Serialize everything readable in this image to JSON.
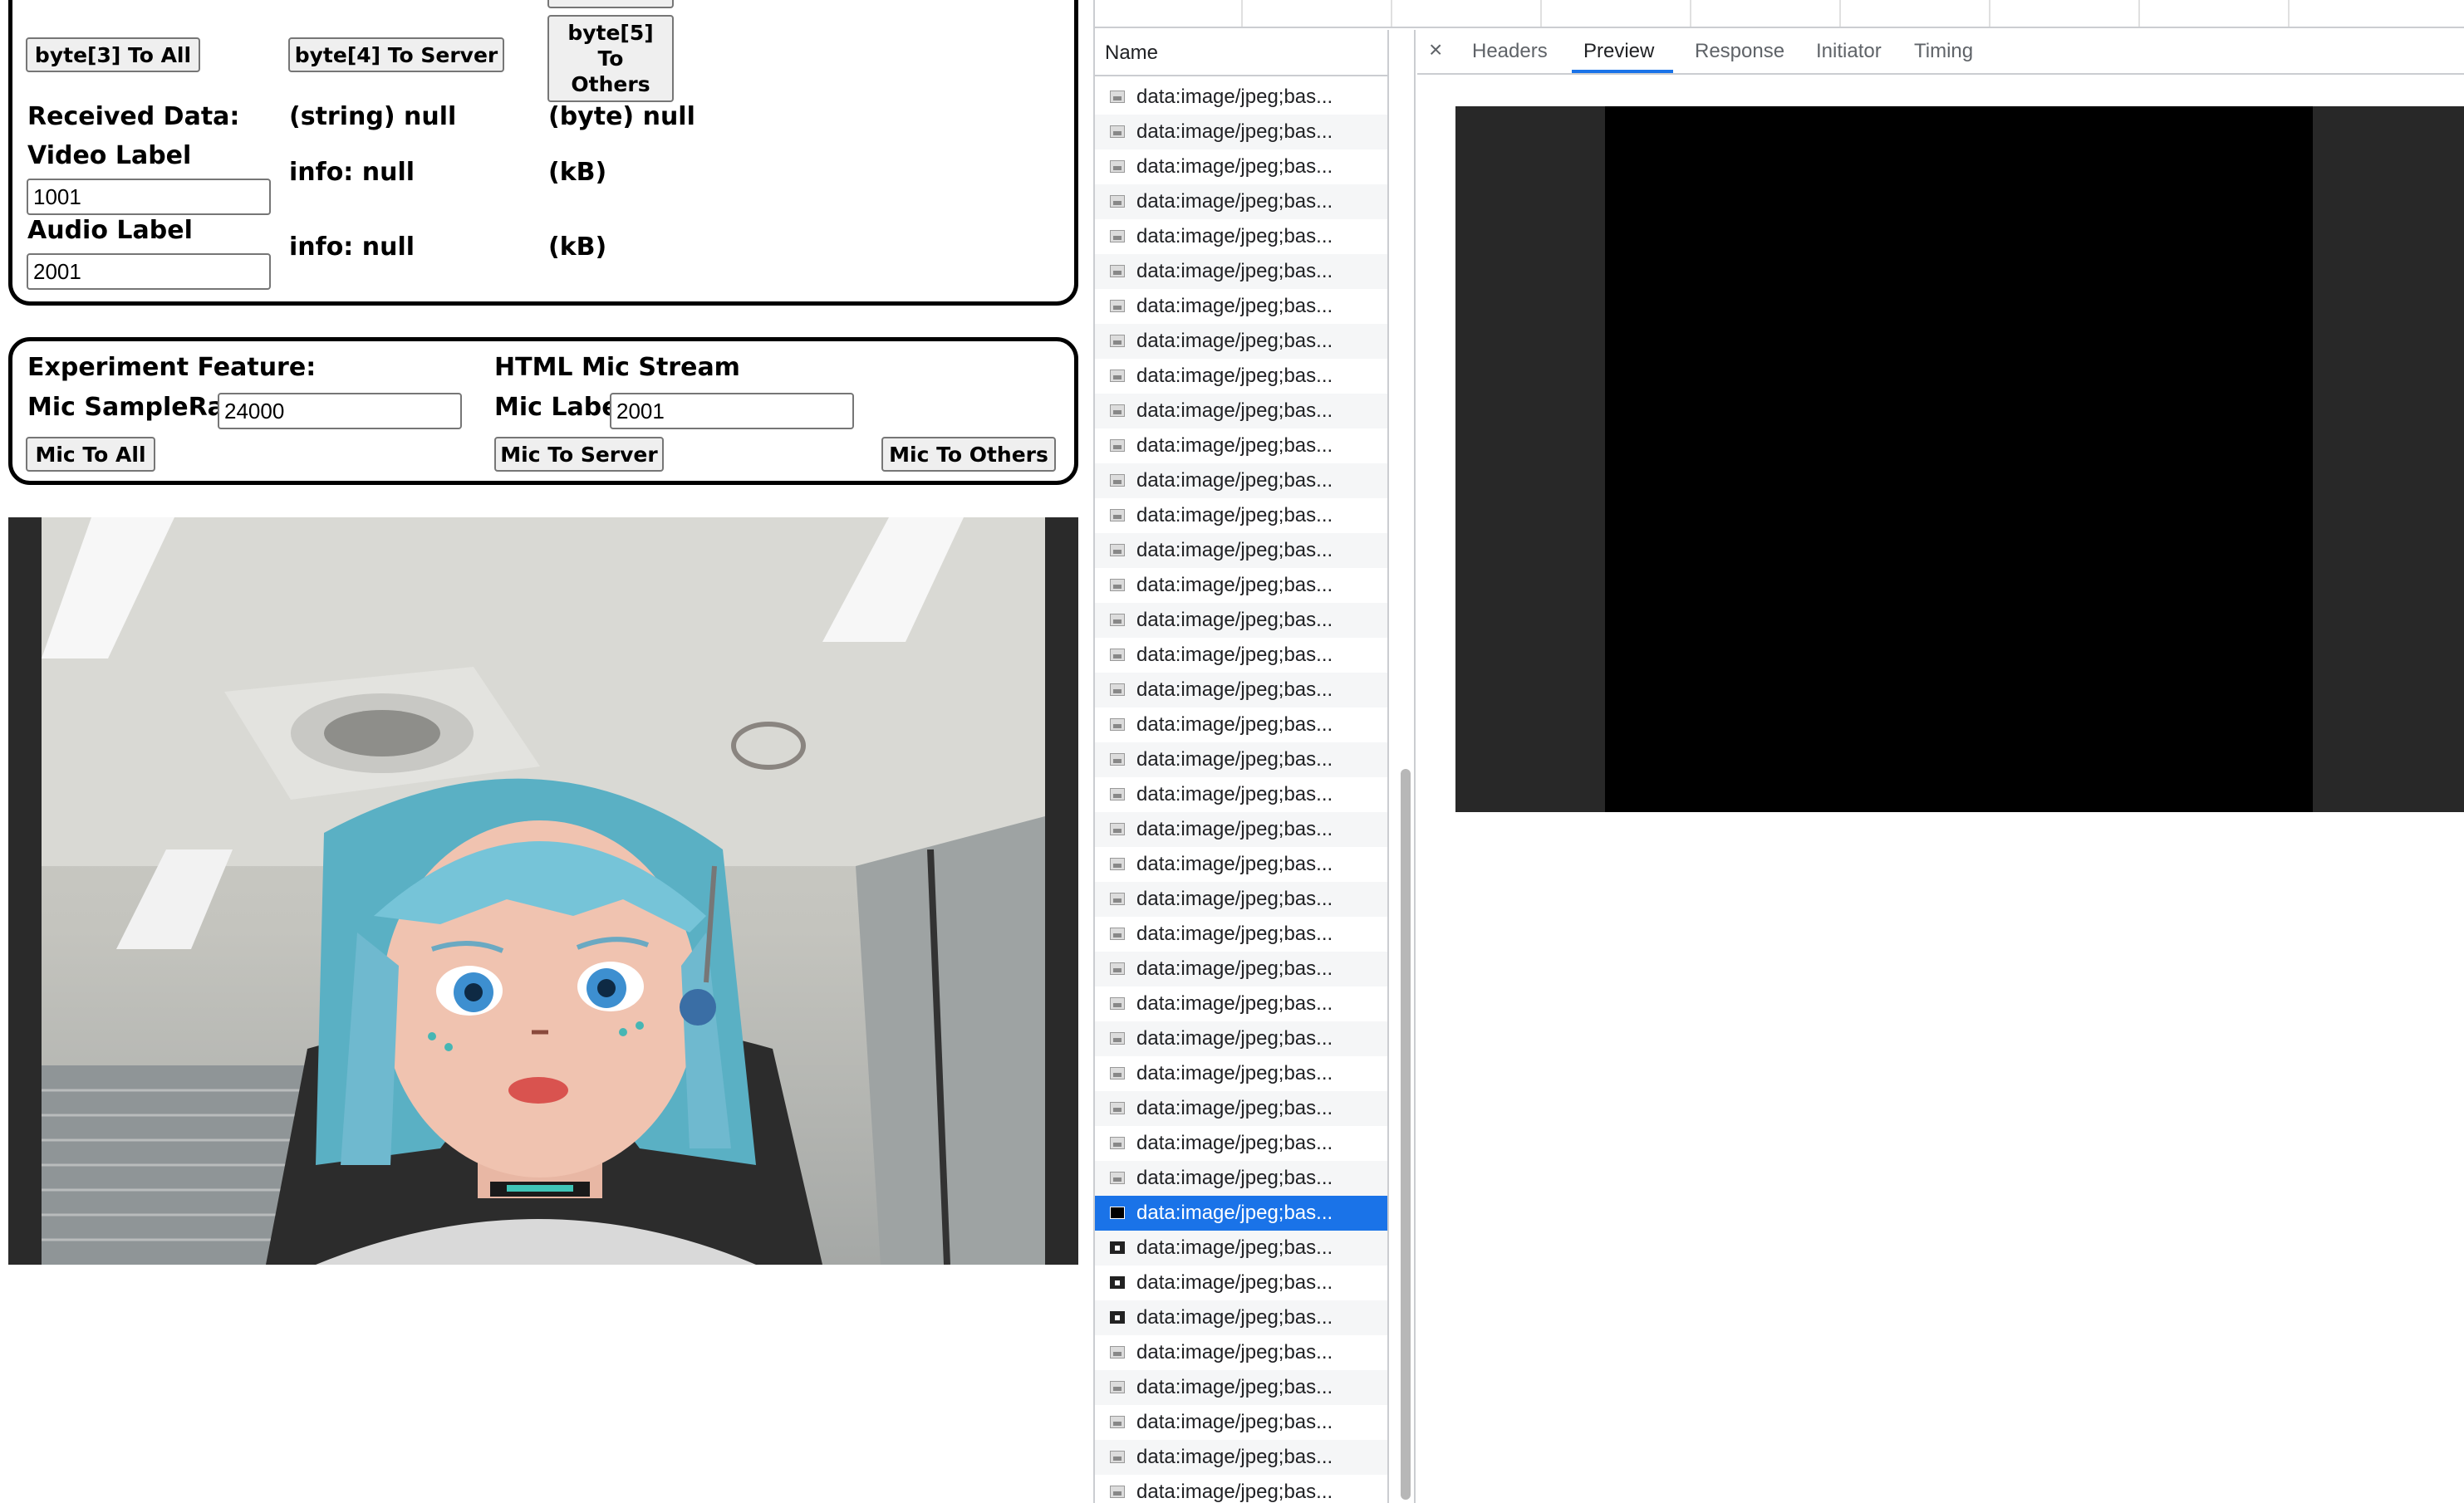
{
  "panel1": {
    "byte3_button": "byte[3] To All",
    "byte4_button": "byte[4] To Server",
    "byte5_button_lines": [
      "byte[5]",
      "To",
      "Others"
    ],
    "received_label": "Received Data:",
    "string_value": "(string) null",
    "byte_value": "(byte) null",
    "video_label": "Video Label",
    "video_value": "1001",
    "video_info": "info: null",
    "video_kb": "(kB)",
    "audio_label": "Audio Label",
    "audio_value": "2001",
    "audio_info": "info: null",
    "audio_kb": "(kB)"
  },
  "panel2": {
    "experiment_label": "Experiment Feature:",
    "html_mic_label": "HTML Mic Stream",
    "samplerate_label": "Mic SampleRate",
    "samplerate_value": "24000",
    "mic_label": "Mic Label",
    "mic_value": "2001",
    "mic_all_button": "Mic To All",
    "mic_server_button": "Mic To Server",
    "mic_others_button": "Mic To Others"
  },
  "devtools": {
    "name_header": "Name",
    "close_glyph": "×",
    "tabs": [
      "Headers",
      "Preview",
      "Response",
      "Initiator",
      "Timing"
    ],
    "active_tab": "Preview",
    "request_name": "data:image/jpeg;bas...",
    "request_count": 41,
    "selected_index": 32,
    "dark_icon_indices": [
      33,
      34,
      35
    ],
    "accent_color": "#1a73e8"
  }
}
